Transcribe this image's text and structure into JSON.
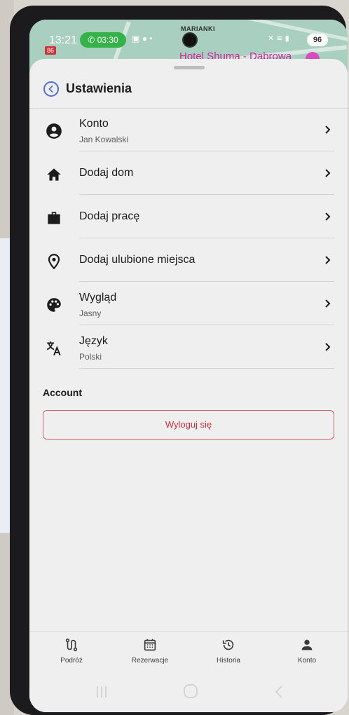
{
  "status_bar": {
    "time": "13:21",
    "call_timer": "03:30",
    "battery": "96",
    "map_label_top": "MARIANKI",
    "map_badge": "86",
    "map_place": "Hotel Shuma - Dąbrowa"
  },
  "header": {
    "title": "Ustawienia"
  },
  "settings": {
    "items": [
      {
        "label": "Konto",
        "sublabel": "Jan Kowalski",
        "icon": "account-circle-icon"
      },
      {
        "label": "Dodaj dom",
        "sublabel": "",
        "icon": "home-icon"
      },
      {
        "label": "Dodaj pracę",
        "sublabel": "",
        "icon": "briefcase-icon"
      },
      {
        "label": "Dodaj ulubione miejsca",
        "sublabel": "",
        "icon": "location-pin-icon"
      },
      {
        "label": "Wygląd",
        "sublabel": "Jasny",
        "icon": "palette-icon"
      },
      {
        "label": "Język",
        "sublabel": "Polski",
        "icon": "translate-icon"
      }
    ]
  },
  "account_section": {
    "title": "Account",
    "logout_label": "Wyloguj się"
  },
  "bottom_nav": {
    "items": [
      {
        "label": "Podróż",
        "icon": "route-icon"
      },
      {
        "label": "Rezerwacje",
        "icon": "calendar-icon"
      },
      {
        "label": "Historia",
        "icon": "history-icon"
      },
      {
        "label": "Konto",
        "icon": "person-icon"
      }
    ]
  },
  "colors": {
    "accent": "#4f6ed6",
    "danger": "#c82f3d",
    "call_green": "#36b24a"
  }
}
